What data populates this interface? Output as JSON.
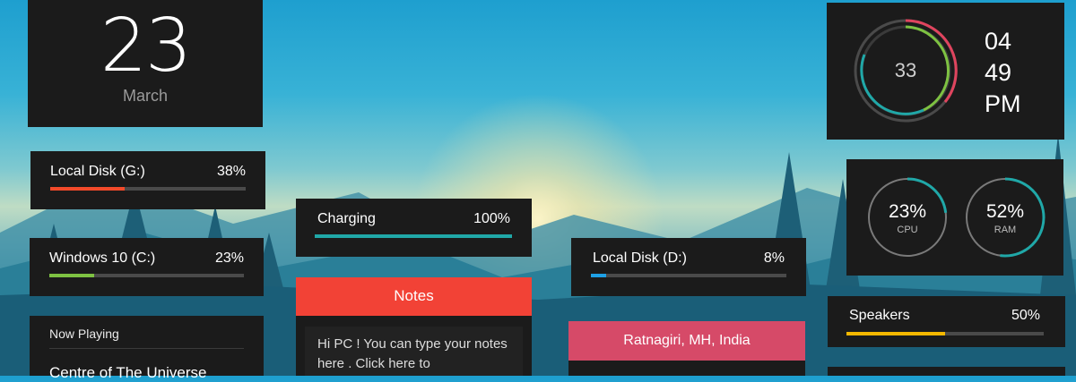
{
  "date": {
    "day": "23",
    "month": "March"
  },
  "disks": {
    "g": {
      "label": "Local Disk (G:)",
      "percent_text": "38%",
      "percent": 38,
      "color": "#f24a2a"
    },
    "c": {
      "label": "Windows 10 (C:)",
      "percent_text": "23%",
      "percent": 23,
      "color": "#7ec242"
    },
    "d": {
      "label": "Local Disk (D:)",
      "percent_text": "8%",
      "percent": 8,
      "color": "#1ea0e6"
    }
  },
  "battery": {
    "label": "Charging",
    "percent_text": "100%",
    "percent": 100,
    "color": "#20a8a8"
  },
  "now_playing": {
    "heading": "Now Playing",
    "song": "Centre of The Universe"
  },
  "notes": {
    "title": "Notes",
    "text": "Hi PC !  You can type your notes here .  Click here to"
  },
  "location": {
    "text": "Ratnagiri, MH, India"
  },
  "clock": {
    "seconds": "33",
    "hour": "04",
    "minute": "49",
    "ampm": "PM"
  },
  "system": {
    "cpu": {
      "value": "23%",
      "label": "CPU",
      "percent": 23
    },
    "ram": {
      "value": "52%",
      "label": "RAM",
      "percent": 52
    },
    "ring_color": "#20a8a8"
  },
  "volume": {
    "label": "Speakers",
    "percent_text": "50%",
    "percent": 50,
    "color": "#f5b800"
  }
}
